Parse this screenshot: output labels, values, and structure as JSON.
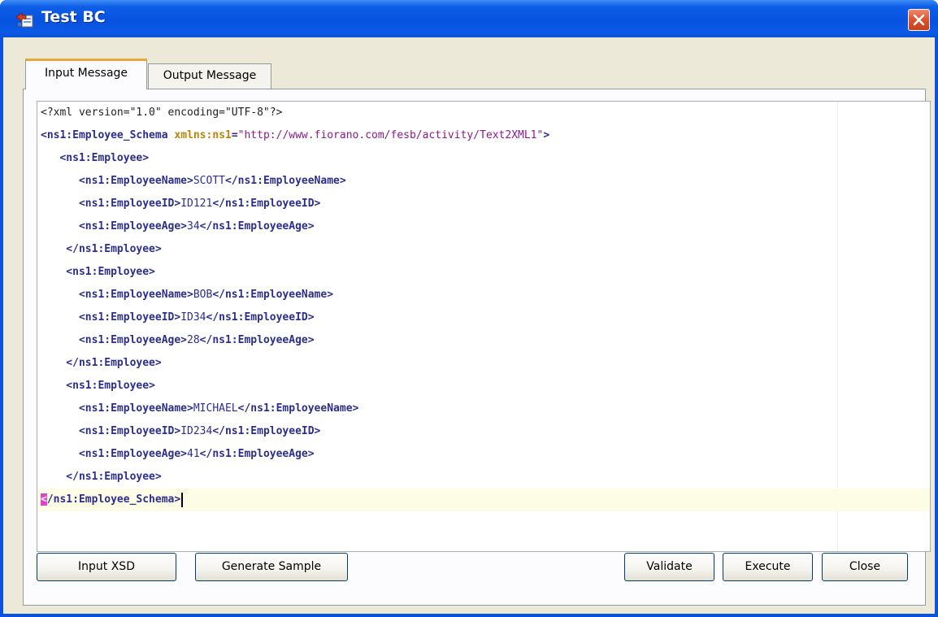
{
  "window": {
    "title": "Test BC",
    "icon": "test-bc-icon",
    "close_icon": "close-icon",
    "colors": {
      "titlebar": "#0752e0",
      "close": "#dc5530",
      "client": "#ece9d8"
    }
  },
  "tabs": [
    {
      "label": "Input Message",
      "active": true
    },
    {
      "label": "Output Message",
      "active": false
    }
  ],
  "editor": {
    "lines": [
      [
        {
          "c": "t-pi",
          "t": "<?xml version=\"1.0\" encoding=\"UTF-8\"?>"
        }
      ],
      [
        {
          "c": "t-tag",
          "t": "<ns1:Employee_Schema "
        },
        {
          "c": "t-attr",
          "t": "xmlns:ns1"
        },
        {
          "c": "t-tag",
          "t": "="
        },
        {
          "c": "t-val",
          "t": "\"http://www.fiorano.com/fesb/activity/Text2XML1\""
        },
        {
          "c": "t-tag",
          "t": ">"
        }
      ],
      [
        {
          "c": "t-tag",
          "t": "   <ns1:Employee>"
        }
      ],
      [
        {
          "c": "t-tag",
          "t": "      <ns1:EmployeeName>"
        },
        {
          "c": "t-text",
          "t": "SCOTT"
        },
        {
          "c": "t-tag",
          "t": "</ns1:EmployeeName>"
        }
      ],
      [
        {
          "c": "t-tag",
          "t": "      <ns1:EmployeeID>"
        },
        {
          "c": "t-text",
          "t": "ID121"
        },
        {
          "c": "t-tag",
          "t": "</ns1:EmployeeID>"
        }
      ],
      [
        {
          "c": "t-tag",
          "t": "      <ns1:EmployeeAge>"
        },
        {
          "c": "t-text",
          "t": "34"
        },
        {
          "c": "t-tag",
          "t": "</ns1:EmployeeAge>"
        }
      ],
      [
        {
          "c": "t-tag",
          "t": "    </ns1:Employee>"
        }
      ],
      [
        {
          "c": "t-tag",
          "t": "    <ns1:Employee>"
        }
      ],
      [
        {
          "c": "t-tag",
          "t": "      <ns1:EmployeeName>"
        },
        {
          "c": "t-text",
          "t": "BOB"
        },
        {
          "c": "t-tag",
          "t": "</ns1:EmployeeName>"
        }
      ],
      [
        {
          "c": "t-tag",
          "t": "      <ns1:EmployeeID>"
        },
        {
          "c": "t-text",
          "t": "ID34"
        },
        {
          "c": "t-tag",
          "t": "</ns1:EmployeeID>"
        }
      ],
      [
        {
          "c": "t-tag",
          "t": "      <ns1:EmployeeAge>"
        },
        {
          "c": "t-text",
          "t": "28"
        },
        {
          "c": "t-tag",
          "t": "</ns1:EmployeeAge>"
        }
      ],
      [
        {
          "c": "t-tag",
          "t": "    </ns1:Employee>"
        }
      ],
      [
        {
          "c": "t-tag",
          "t": "    <ns1:Employee>"
        }
      ],
      [
        {
          "c": "t-tag",
          "t": "      <ns1:EmployeeName>"
        },
        {
          "c": "t-text",
          "t": "MICHAEL"
        },
        {
          "c": "t-tag",
          "t": "</ns1:EmployeeName>"
        }
      ],
      [
        {
          "c": "t-tag",
          "t": "      <ns1:EmployeeID>"
        },
        {
          "c": "t-text",
          "t": "ID234"
        },
        {
          "c": "t-tag",
          "t": "</ns1:EmployeeID>"
        }
      ],
      [
        {
          "c": "t-tag",
          "t": "      <ns1:EmployeeAge>"
        },
        {
          "c": "t-text",
          "t": "41"
        },
        {
          "c": "t-tag",
          "t": "</ns1:EmployeeAge>"
        }
      ],
      [
        {
          "c": "t-tag",
          "t": "    </ns1:Employee>"
        }
      ],
      [
        {
          "c": "bracket-hl t-tag",
          "t": "<"
        },
        {
          "c": "t-tag",
          "t": "/ns1:Employee_Schema>"
        }
      ]
    ],
    "current_line": 17,
    "colors": {
      "tag": "#2b2e8c",
      "attr": "#b8860b",
      "value": "#8b1a8b",
      "current_line": "#fdfce5",
      "bracket_highlight": "#e043c8"
    }
  },
  "buttons": {
    "input_xsd": "Input XSD",
    "generate_sample": "Generate Sample",
    "validate": "Validate",
    "execute": "Execute",
    "close": "Close"
  }
}
